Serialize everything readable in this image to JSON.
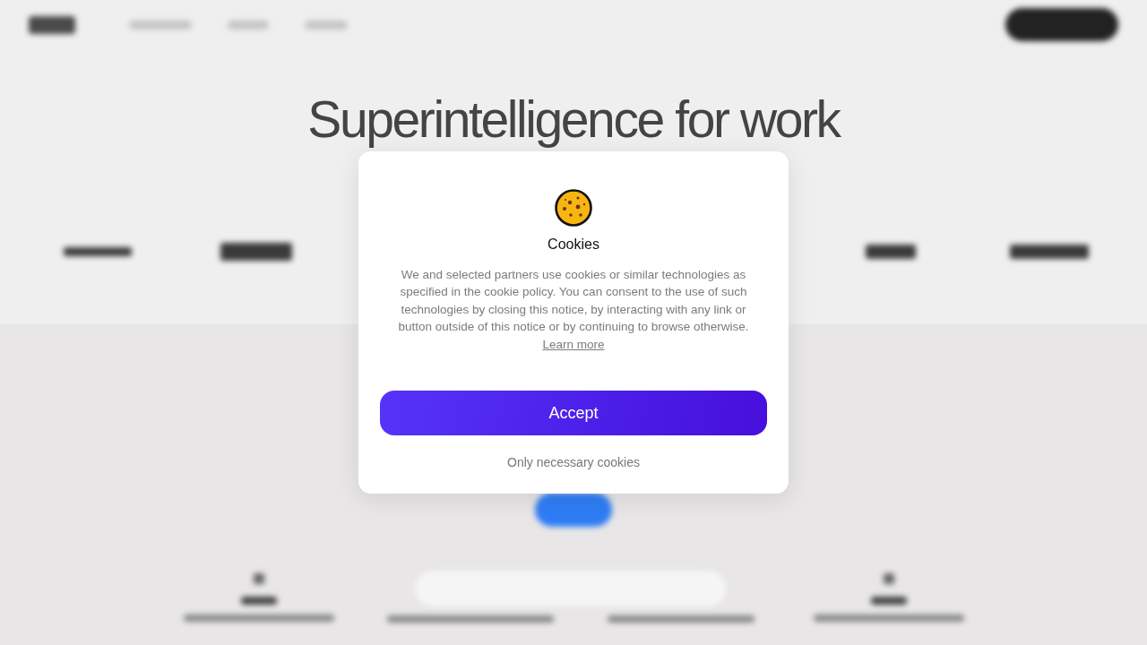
{
  "page": {
    "headline": "Superintelligence for work"
  },
  "cookie_dialog": {
    "title": "Cookies",
    "body": "We and selected partners use cookies or similar technologies as specified in the cookie policy. You can consent to the use of such technologies by closing this notice, by interacting with any link or button outside of this notice or by continuing to browse otherwise.",
    "learn_more_link": "Learn more",
    "accept_button": "Accept",
    "necessary_only_button": "Only necessary cookies"
  }
}
